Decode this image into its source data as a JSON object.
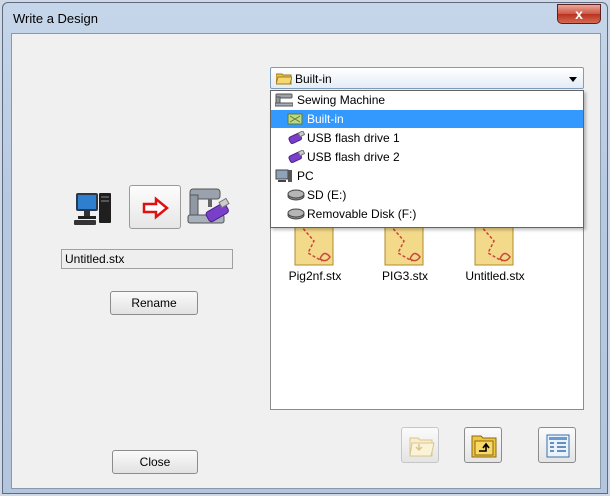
{
  "window": {
    "title": "Write a Design",
    "close_glyph": "x"
  },
  "left_panel": {
    "source_icon": "computer-icon",
    "arrow_icon": "red-right-arrow-icon",
    "target_icon": "sewing-machine-usb-icon",
    "filename_value": "Untitled.stx",
    "rename_label": "Rename",
    "close_label": "Close"
  },
  "location_combo": {
    "selected": "Built-in",
    "icon": "folder-icon"
  },
  "dropdown": {
    "items": [
      {
        "label": "Sewing Machine",
        "icon": "sewing-machine-icon",
        "level": 0,
        "selected": false
      },
      {
        "label": "Built-in",
        "icon": "builtin-memory-icon",
        "level": 1,
        "selected": true
      },
      {
        "label": "USB flash drive 1",
        "icon": "usb-drive-icon",
        "level": 1,
        "selected": false
      },
      {
        "label": "USB flash drive 2",
        "icon": "usb-drive-icon",
        "level": 1,
        "selected": false
      },
      {
        "label": "PC",
        "icon": "pc-icon",
        "level": 0,
        "selected": false
      },
      {
        "label": "SD (E:)",
        "icon": "disk-icon",
        "level": 1,
        "selected": false
      },
      {
        "label": "Removable Disk (F:)",
        "icon": "disk-icon",
        "level": 1,
        "selected": false
      }
    ]
  },
  "files": [
    {
      "name": "Pig2nf.stx",
      "icon": "embroidery-file-icon"
    },
    {
      "name": "PIG3.stx",
      "icon": "embroidery-file-icon"
    },
    {
      "name": "Untitled.stx",
      "icon": "embroidery-file-icon"
    }
  ],
  "toolbar": {
    "new_folder_icon": "new-folder-icon",
    "up_folder_icon": "up-folder-icon",
    "view_icon": "details-view-icon"
  }
}
